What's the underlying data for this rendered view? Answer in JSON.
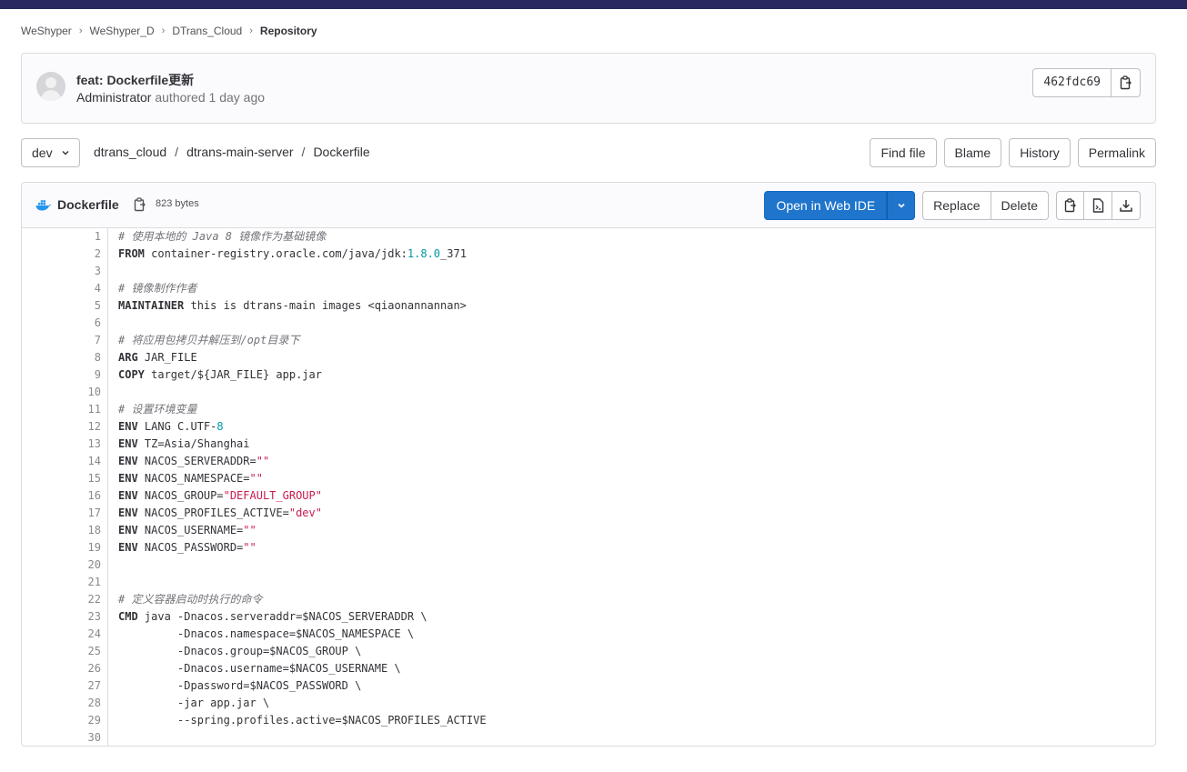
{
  "breadcrumb": [
    {
      "label": "WeShyper"
    },
    {
      "label": "WeShyper_D"
    },
    {
      "label": "DTrans_Cloud"
    },
    {
      "label": "Repository"
    }
  ],
  "commit": {
    "title": "feat: Dockerfile更新",
    "author": "Administrator",
    "meta": " authored 1 day ago",
    "sha": "462fdc69"
  },
  "nav": {
    "branch": "dev",
    "path": [
      "dtrans_cloud",
      "dtrans-main-server",
      "Dockerfile"
    ],
    "buttons": [
      "Find file",
      "Blame",
      "History",
      "Permalink"
    ]
  },
  "file": {
    "name": "Dockerfile",
    "size": "823 bytes",
    "open_ide_label": "Open in Web IDE",
    "replace_label": "Replace",
    "delete_label": "Delete"
  },
  "icons": {
    "file": "docker-icon",
    "copy": "copy-icon",
    "raw": "file-raw-icon",
    "download": "download-icon"
  },
  "colors": {
    "primary": "#1f75cb",
    "topbar": "#292961",
    "string": "#c91c4d",
    "number": "#0097a7",
    "comment": "#737278"
  },
  "code_lines": [
    [
      {
        "t": "# 使用本地的 Java 8 镜像作为基础镜像",
        "c": "cm"
      }
    ],
    [
      {
        "t": "FROM",
        "c": "kw"
      },
      {
        "t": " container-registry.oracle.com/java/jdk:"
      },
      {
        "t": "1.8.0",
        "c": "num"
      },
      {
        "t": "_371"
      }
    ],
    [],
    [
      {
        "t": "# 镜像制作作者",
        "c": "cm"
      }
    ],
    [
      {
        "t": "MAINTAINER",
        "c": "kw"
      },
      {
        "t": " this is dtrans-main images <qiaonannannan>"
      }
    ],
    [],
    [
      {
        "t": "# 将应用包拷贝并解压到/opt目录下",
        "c": "cm"
      }
    ],
    [
      {
        "t": "ARG",
        "c": "kw"
      },
      {
        "t": " JAR_FILE"
      }
    ],
    [
      {
        "t": "COPY",
        "c": "kw"
      },
      {
        "t": " target/${JAR_FILE} app.jar"
      }
    ],
    [],
    [
      {
        "t": "# 设置环境变量",
        "c": "cm"
      }
    ],
    [
      {
        "t": "ENV",
        "c": "kw"
      },
      {
        "t": " LANG C.UTF-"
      },
      {
        "t": "8",
        "c": "num"
      }
    ],
    [
      {
        "t": "ENV",
        "c": "kw"
      },
      {
        "t": " TZ=Asia/Shanghai"
      }
    ],
    [
      {
        "t": "ENV",
        "c": "kw"
      },
      {
        "t": " NACOS_SERVERADDR="
      },
      {
        "t": "\"\"",
        "c": "str"
      }
    ],
    [
      {
        "t": "ENV",
        "c": "kw"
      },
      {
        "t": " NACOS_NAMESPACE="
      },
      {
        "t": "\"\"",
        "c": "str"
      }
    ],
    [
      {
        "t": "ENV",
        "c": "kw"
      },
      {
        "t": " NACOS_GROUP="
      },
      {
        "t": "\"DEFAULT_GROUP\"",
        "c": "str"
      }
    ],
    [
      {
        "t": "ENV",
        "c": "kw"
      },
      {
        "t": " NACOS_PROFILES_ACTIVE="
      },
      {
        "t": "\"dev\"",
        "c": "str"
      }
    ],
    [
      {
        "t": "ENV",
        "c": "kw"
      },
      {
        "t": " NACOS_USERNAME="
      },
      {
        "t": "\"\"",
        "c": "str"
      }
    ],
    [
      {
        "t": "ENV",
        "c": "kw"
      },
      {
        "t": " NACOS_PASSWORD="
      },
      {
        "t": "\"\"",
        "c": "str"
      }
    ],
    [],
    [],
    [
      {
        "t": "# 定义容器启动时执行的命令",
        "c": "cm"
      }
    ],
    [
      {
        "t": "CMD",
        "c": "kw"
      },
      {
        "t": " java -Dnacos.serveraddr=$NACOS_SERVERADDR \\"
      }
    ],
    [
      {
        "t": "         -Dnacos.namespace=$NACOS_NAMESPACE \\"
      }
    ],
    [
      {
        "t": "         -Dnacos.group=$NACOS_GROUP \\"
      }
    ],
    [
      {
        "t": "         -Dnacos.username=$NACOS_USERNAME \\"
      }
    ],
    [
      {
        "t": "         -Dpassword=$NACOS_PASSWORD \\"
      }
    ],
    [
      {
        "t": "         -jar app.jar \\"
      }
    ],
    [
      {
        "t": "         --spring.profiles.active=$NACOS_PROFILES_ACTIVE"
      }
    ],
    []
  ]
}
